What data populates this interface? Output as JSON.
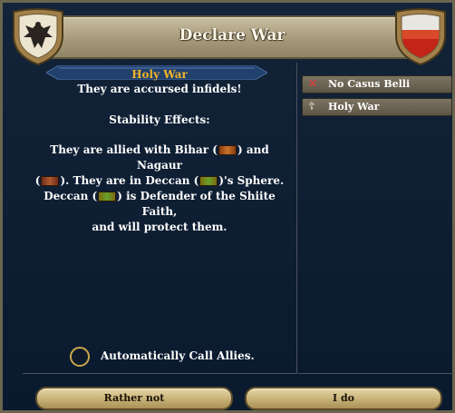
{
  "window": {
    "title": "Declare War"
  },
  "casus_belli": {
    "selected_title": "Holy War",
    "description": "They are accursed infidels!",
    "stability_label": "Stability Effects:",
    "effects": {
      "t1": "They are allied with Bihar (",
      "t2": ") and Nagaur",
      "t3": "(",
      "t4": "). They are in Deccan (",
      "t5": ")'s Sphere.",
      "t6": "Deccan (",
      "t7": ") is Defender of the Shiite Faith,",
      "t8": "and will protect them."
    },
    "options": [
      {
        "label": "No Casus Belli",
        "icon": "cross-icon"
      },
      {
        "label": "Holy War",
        "icon": "holy-cross-icon"
      }
    ]
  },
  "auto_call_allies": {
    "label": "Automatically Call Allies.",
    "checked": false
  },
  "buttons": {
    "cancel": "Rather not",
    "confirm": "I do"
  },
  "colors": {
    "title_orange": "#f0b428",
    "panel_bg": "#0b1626",
    "button_gold": "#c9b47a"
  }
}
